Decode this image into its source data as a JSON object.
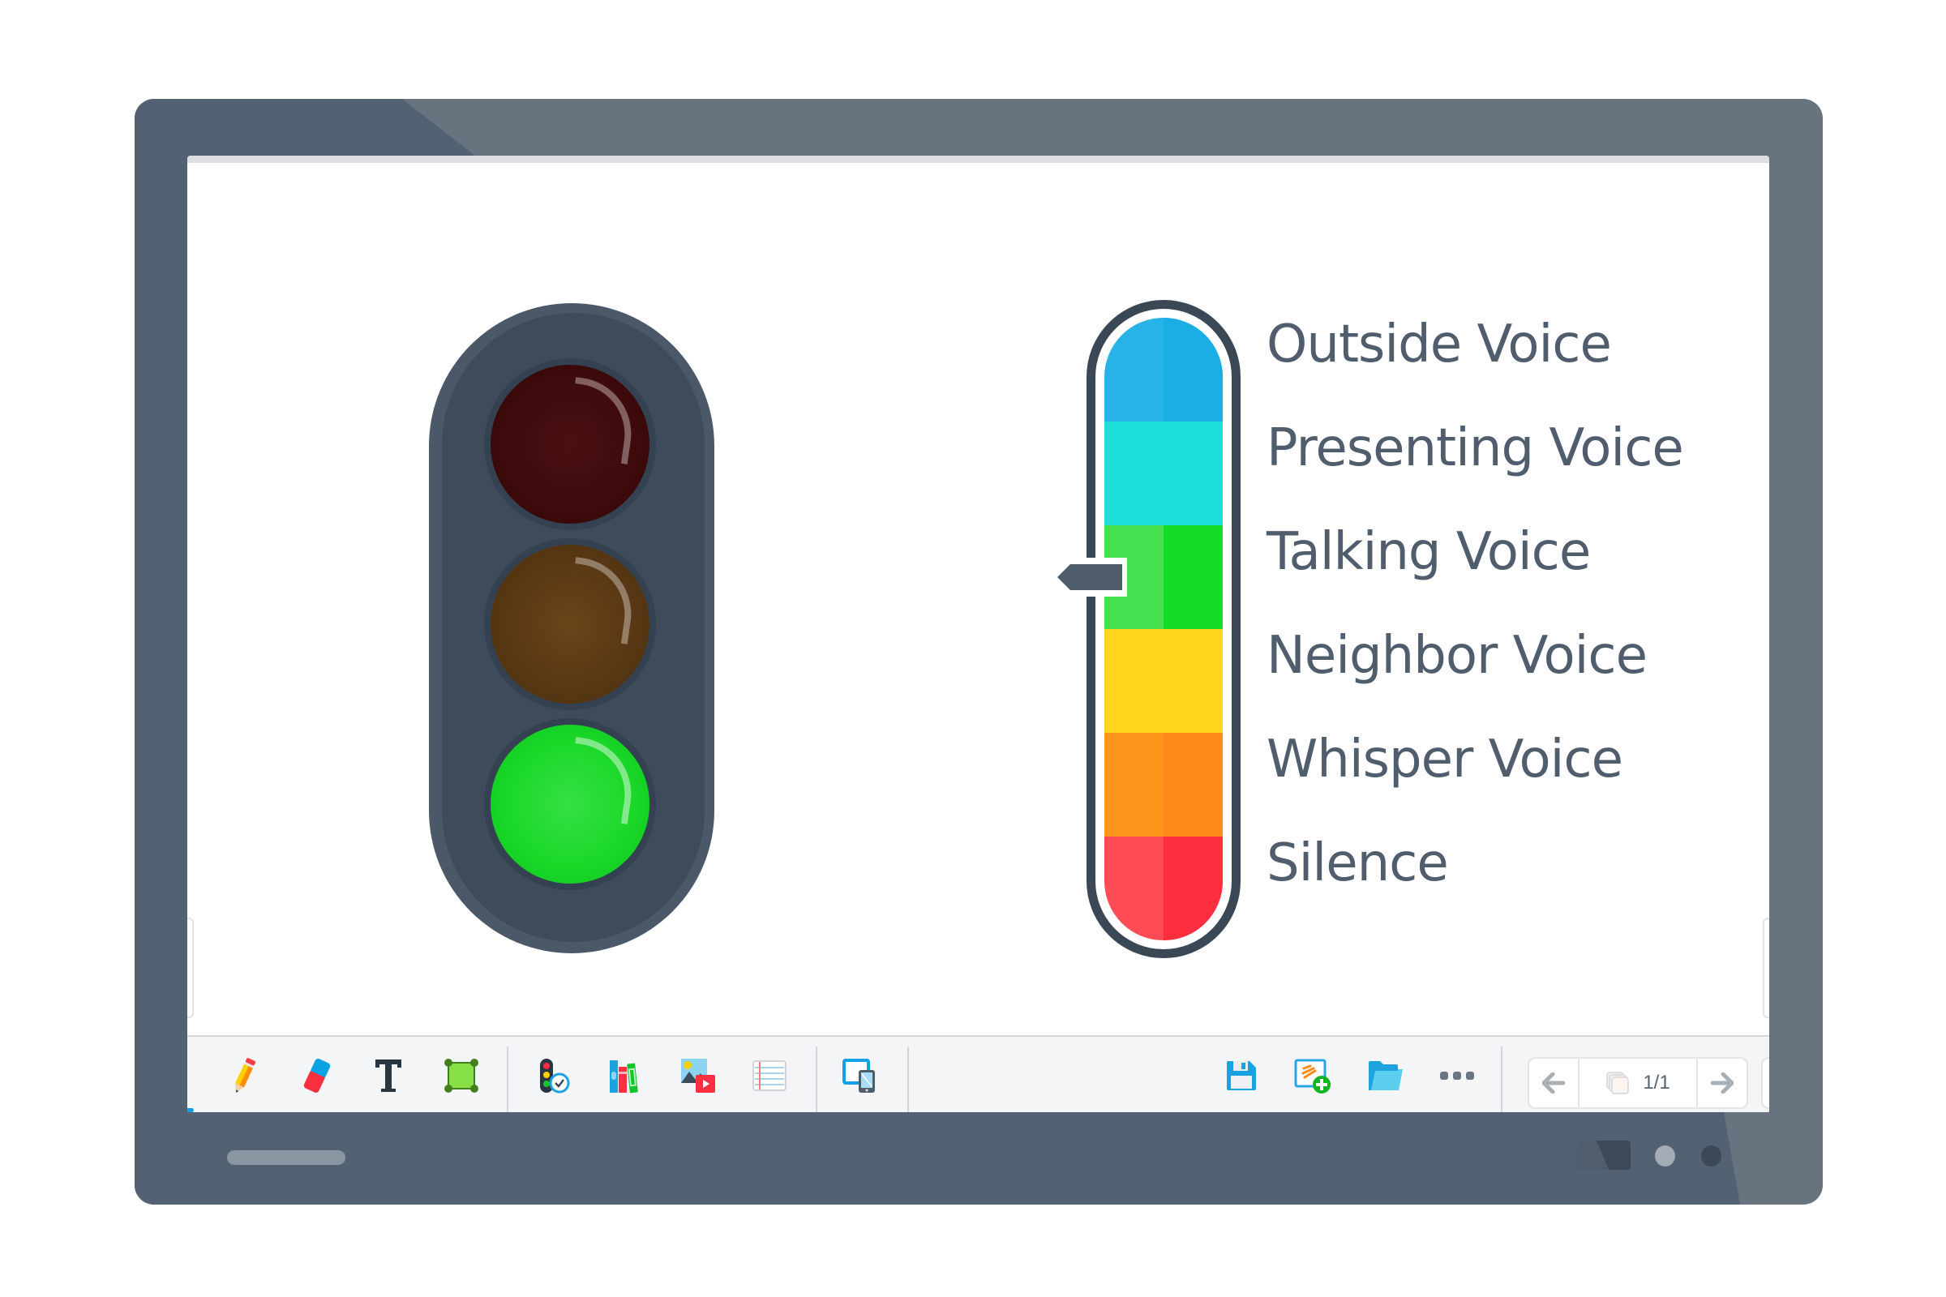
{
  "device": {
    "type": "interactive display",
    "colors": {
      "bezel": "#67737f",
      "bezel_shade": "#536273"
    }
  },
  "canvas": {
    "traffic_light": {
      "lamps": [
        {
          "name": "red",
          "state": "off",
          "color": "#3e0a0c"
        },
        {
          "name": "amber",
          "state": "off",
          "color": "#593814"
        },
        {
          "name": "green",
          "state": "on",
          "color": "#1bd829"
        }
      ]
    },
    "voice_meter": {
      "levels": [
        {
          "label": "Outside Voice",
          "color": "#27b3e8",
          "shade": "#1aaee5"
        },
        {
          "label": "Presenting Voice",
          "color": "#1ddfd9",
          "shade": "#1ddfd9"
        },
        {
          "label": "Talking Voice",
          "color": "#45e04f",
          "shade": "#13dd27"
        },
        {
          "label": "Neighbor Voice",
          "color": "#ffd41c",
          "shade": "#ffd41c"
        },
        {
          "label": "Whisper Voice",
          "color": "#fe951b",
          "shade": "#fe8a1c"
        },
        {
          "label": "Silence",
          "color": "#ff4b55",
          "shade": "#fd2f3e"
        }
      ],
      "selected_level": "Talking Voice",
      "selected_index": 2
    }
  },
  "toolbar": {
    "tools": [
      {
        "id": "pen",
        "label": "Pen",
        "icon": "pencil-icon"
      },
      {
        "id": "eraser",
        "label": "Eraser",
        "icon": "eraser-icon"
      },
      {
        "id": "text",
        "label": "Text",
        "icon": "text-icon"
      },
      {
        "id": "shape",
        "label": "Shape",
        "icon": "shape-select-icon"
      }
    ],
    "widgets": [
      {
        "id": "classroom-tools",
        "label": "Classroom tools",
        "icon": "traffic-light-timer-icon"
      },
      {
        "id": "library",
        "label": "Library",
        "icon": "books-icon"
      },
      {
        "id": "media",
        "label": "Media",
        "icon": "image-video-icon"
      },
      {
        "id": "background",
        "label": "Background",
        "icon": "lined-paper-icon"
      }
    ],
    "cast": {
      "id": "screen-share",
      "label": "Screen share",
      "icon": "device-cast-icon"
    },
    "file_actions": [
      {
        "id": "save",
        "label": "Save",
        "icon": "save-icon"
      },
      {
        "id": "add-page",
        "label": "Add page",
        "icon": "add-page-icon"
      },
      {
        "id": "open",
        "label": "Open",
        "icon": "folder-icon"
      },
      {
        "id": "more",
        "label": "More",
        "icon": "more-icon"
      }
    ],
    "pager": {
      "current": 1,
      "total": 1,
      "text": "1/1"
    }
  }
}
